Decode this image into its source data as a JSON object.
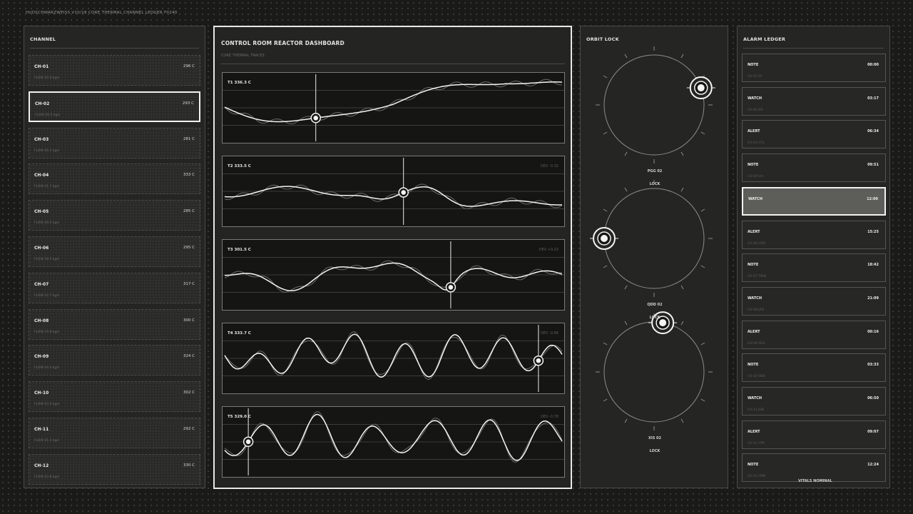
{
  "header": {
    "caption": "HUDSCHWARZWEISS V10/18 CORE THERMAL CHANNEL LEDGER F0240"
  },
  "channel_panel": {
    "title": "CHANNEL",
    "selected_index": 1,
    "items": [
      {
        "name": "CH-01",
        "temp": "296 C",
        "flow": "FLOW 22.6 kg/s"
      },
      {
        "name": "CH-02",
        "temp": "293 C",
        "flow": "FLOW 20.5 kg/s"
      },
      {
        "name": "CH-03",
        "temp": "281 C",
        "flow": "FLOW 20.1 kg/s"
      },
      {
        "name": "CH-04",
        "temp": "333 C",
        "flow": "FLOW 21.7 kg/s"
      },
      {
        "name": "CH-05",
        "temp": "285 C",
        "flow": "FLOW 20.5 kg/s"
      },
      {
        "name": "CH-06",
        "temp": "295 C",
        "flow": "FLOW 18.5 kg/s"
      },
      {
        "name": "CH-07",
        "temp": "317 C",
        "flow": "FLOW 22.7 kg/s"
      },
      {
        "name": "CH-08",
        "temp": "300 C",
        "flow": "FLOW 19.8 kg/s"
      },
      {
        "name": "CH-09",
        "temp": "324 C",
        "flow": "FLOW 24.4 kg/s"
      },
      {
        "name": "CH-10",
        "temp": "302 C",
        "flow": "FLOW 23.5 kg/s"
      },
      {
        "name": "CH-11",
        "temp": "292 C",
        "flow": "FLOW 21.2 kg/s"
      },
      {
        "name": "CH-12",
        "temp": "330 C",
        "flow": "FLOW 23.8 kg/s"
      }
    ]
  },
  "dashboard": {
    "title": "CONTROL ROOM REACTOR DASHBOARD",
    "subtitle": "CORE THERMAL TRACES",
    "traces": [
      {
        "label": "T1 336.3 C",
        "dev": "",
        "cursor": 0.27
      },
      {
        "label": "T2 333.5 C",
        "dev": "DEV -0.32",
        "cursor": 0.53
      },
      {
        "label": "T3 301.5 C",
        "dev": "DEV +0.22",
        "cursor": 0.67
      },
      {
        "label": "T4 333.7 C",
        "dev": "DEV -0.86",
        "cursor": 0.93
      },
      {
        "label": "T5 329.0 C",
        "dev": "DEV -0.78",
        "cursor": 0.07
      }
    ]
  },
  "orbit_panel": {
    "title": "ORBIT LOCK",
    "rings": [
      {
        "name": "PGG 02",
        "status": "LOCK",
        "angle_deg": 70
      },
      {
        "name": "QDD 02",
        "status": "LOCK",
        "angle_deg": 270
      },
      {
        "name": "XIS 02",
        "status": "LOCK",
        "angle_deg": 10
      }
    ]
  },
  "alarm_panel": {
    "title": "ALARM LEDGER",
    "selected_index": 4,
    "entries": [
      {
        "level": "NOTE",
        "time": "00:00",
        "source": "CH-01 RF"
      },
      {
        "level": "WATCH",
        "time": "03:17",
        "source": "CH-02 KD"
      },
      {
        "level": "ALERT",
        "time": "06:34",
        "source": "CH-03 VCL"
      },
      {
        "level": "NOTE",
        "time": "09:51",
        "source": "CH-04 UH"
      },
      {
        "level": "WATCH",
        "time": "12:00",
        "source": ""
      },
      {
        "level": "ALERT",
        "time": "15:25",
        "source": "CH-06 UQX"
      },
      {
        "level": "NOTE",
        "time": "18:42",
        "source": "CH-07 TWN"
      },
      {
        "level": "WATCH",
        "time": "21:09",
        "source": "CH-08 JZD"
      },
      {
        "level": "ALERT",
        "time": "00:16",
        "source": "CH-09 SDS"
      },
      {
        "level": "NOTE",
        "time": "03:33",
        "source": "CH-10 SBB"
      },
      {
        "level": "WATCH",
        "time": "06:50",
        "source": "CH-11 JUB"
      },
      {
        "level": "ALERT",
        "time": "09:07",
        "source": "CH-12 YPR"
      },
      {
        "level": "NOTE",
        "time": "12:24",
        "source": "CH-01 FMN"
      }
    ],
    "footer": "VITALS NOMINAL"
  }
}
